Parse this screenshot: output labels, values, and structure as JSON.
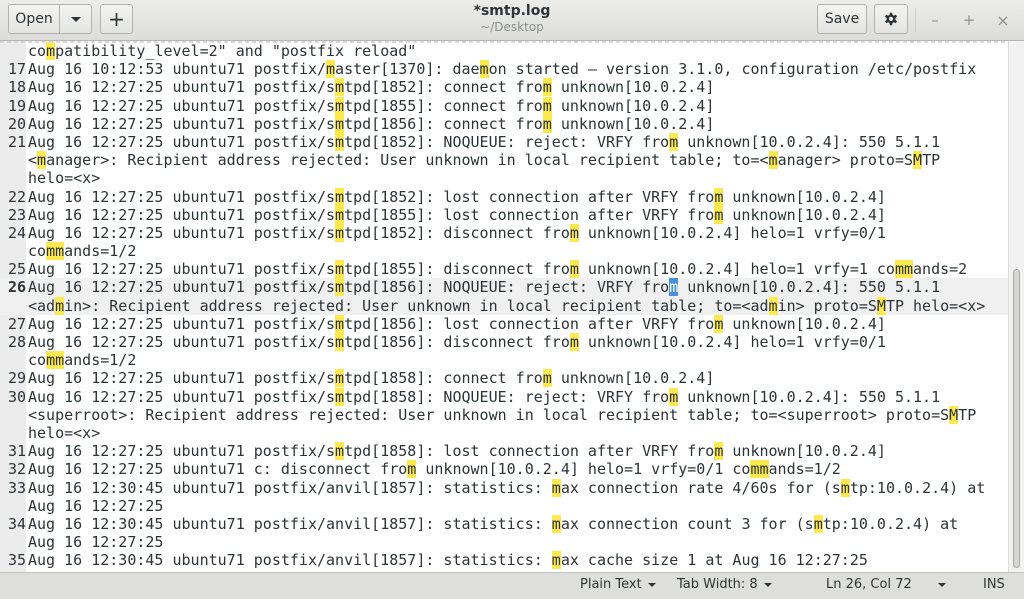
{
  "header": {
    "open_label": "Open",
    "new_tab_label": "+",
    "title": "*smtp.log",
    "subtitle": "~/Desktop",
    "save_label": "Save",
    "minimize_label": "–",
    "maximize_label": "+",
    "close_label": "×"
  },
  "editor": {
    "current_line": 26,
    "scroll": {
      "thumb_start": 0.43,
      "thumb_end": 1.0
    },
    "lines": [
      {
        "num": "",
        "rows": [
          [
            [
              "co"
            ],
            [
              "m",
              "hl"
            ],
            [
              "patibility_level=2\" and \"postfix reload\""
            ]
          ]
        ]
      },
      {
        "num": "17",
        "rows": [
          [
            [
              "Aug 16 10:12:53 ubuntu71 postfix/"
            ],
            [
              "m",
              "hl"
            ],
            [
              "aster[1370]: dae"
            ],
            [
              "m",
              "hl"
            ],
            [
              "on started – version 3.1.0, configuration /etc/postfix"
            ]
          ]
        ]
      },
      {
        "num": "18",
        "rows": [
          [
            [
              "Aug 16 12:27:25 ubuntu71 postfix/s"
            ],
            [
              "m",
              "hl"
            ],
            [
              "tpd[1852]: connect fro"
            ],
            [
              "m",
              "hl"
            ],
            [
              " unknown[10.0.2.4]"
            ]
          ]
        ]
      },
      {
        "num": "19",
        "rows": [
          [
            [
              "Aug 16 12:27:25 ubuntu71 postfix/s"
            ],
            [
              "m",
              "hl"
            ],
            [
              "tpd[1855]: connect fro"
            ],
            [
              "m",
              "hl"
            ],
            [
              " unknown[10.0.2.4]"
            ]
          ]
        ]
      },
      {
        "num": "20",
        "rows": [
          [
            [
              "Aug 16 12:27:25 ubuntu71 postfix/s"
            ],
            [
              "m",
              "hl"
            ],
            [
              "tpd[1856]: connect fro"
            ],
            [
              "m",
              "hl"
            ],
            [
              " unknown[10.0.2.4]"
            ]
          ]
        ]
      },
      {
        "num": "21",
        "rows": [
          [
            [
              "Aug 16 12:27:25 ubuntu71 postfix/s"
            ],
            [
              "m",
              "hl"
            ],
            [
              "tpd[1852]: NOQUEUE: reject: VRFY fro"
            ],
            [
              "m",
              "hl"
            ],
            [
              " unknown[10.0.2.4]: 550 5.1.1"
            ]
          ],
          [
            [
              "<"
            ],
            [
              "m",
              "hl"
            ],
            [
              "anager>: Recipient address rejected: User unknown in local recipient table; to=<"
            ],
            [
              "m",
              "hl"
            ],
            [
              "anager> proto=S"
            ],
            [
              "M",
              "hl"
            ],
            [
              "TP"
            ]
          ],
          [
            [
              "helo=<x>"
            ]
          ]
        ]
      },
      {
        "num": "22",
        "rows": [
          [
            [
              "Aug 16 12:27:25 ubuntu71 postfix/s"
            ],
            [
              "m",
              "hl"
            ],
            [
              "tpd[1852]: lost connection after VRFY fro"
            ],
            [
              "m",
              "hl"
            ],
            [
              " unknown[10.0.2.4]"
            ]
          ]
        ]
      },
      {
        "num": "23",
        "rows": [
          [
            [
              "Aug 16 12:27:25 ubuntu71 postfix/s"
            ],
            [
              "m",
              "hl"
            ],
            [
              "tpd[1855]: lost connection after VRFY fro"
            ],
            [
              "m",
              "hl"
            ],
            [
              " unknown[10.0.2.4]"
            ]
          ]
        ]
      },
      {
        "num": "24",
        "rows": [
          [
            [
              "Aug 16 12:27:25 ubuntu71 postfix/s"
            ],
            [
              "m",
              "hl"
            ],
            [
              "tpd[1852]: disconnect fro"
            ],
            [
              "m",
              "hl"
            ],
            [
              " unknown[10.0.2.4] helo=1 vrfy=0/1"
            ]
          ],
          [
            [
              "co"
            ],
            [
              "mm",
              "hl"
            ],
            [
              "ands=1/2"
            ]
          ]
        ]
      },
      {
        "num": "25",
        "rows": [
          [
            [
              "Aug 16 12:27:25 ubuntu71 postfix/s"
            ],
            [
              "m",
              "hl"
            ],
            [
              "tpd[1855]: disconnect fro"
            ],
            [
              "m",
              "hl"
            ],
            [
              " unknown[10.0.2.4] helo=1 vrfy=1 co"
            ],
            [
              "mm",
              "hl"
            ],
            [
              "ands=2"
            ]
          ]
        ]
      },
      {
        "num": "26",
        "rows": [
          [
            [
              "Aug 16 12:27:25 ubuntu71 postfix/s"
            ],
            [
              "m",
              "hl"
            ],
            [
              "tpd[1856]: NOQUEUE: reject: VRFY fro"
            ],
            [
              "m",
              "cur"
            ],
            [
              " unknown[10.0.2.4]: 550 5.1.1"
            ]
          ],
          [
            [
              "<ad"
            ],
            [
              "m",
              "hl"
            ],
            [
              "in>: Recipient address rejected: User unknown in local recipient table; to=<ad"
            ],
            [
              "m",
              "hl"
            ],
            [
              "in> proto=S"
            ],
            [
              "M",
              "hl"
            ],
            [
              "TP helo=<x>"
            ]
          ]
        ]
      },
      {
        "num": "27",
        "rows": [
          [
            [
              "Aug 16 12:27:25 ubuntu71 postfix/s"
            ],
            [
              "m",
              "hl"
            ],
            [
              "tpd[1856]: lost connection after VRFY fro"
            ],
            [
              "m",
              "hl"
            ],
            [
              " unknown[10.0.2.4]"
            ]
          ]
        ]
      },
      {
        "num": "28",
        "rows": [
          [
            [
              "Aug 16 12:27:25 ubuntu71 postfix/s"
            ],
            [
              "m",
              "hl"
            ],
            [
              "tpd[1856]: disconnect fro"
            ],
            [
              "m",
              "hl"
            ],
            [
              " unknown[10.0.2.4] helo=1 vrfy=0/1"
            ]
          ],
          [
            [
              "co"
            ],
            [
              "mm",
              "hl"
            ],
            [
              "ands=1/2"
            ]
          ]
        ]
      },
      {
        "num": "29",
        "rows": [
          [
            [
              "Aug 16 12:27:25 ubuntu71 postfix/s"
            ],
            [
              "m",
              "hl"
            ],
            [
              "tpd[1858]: connect fro"
            ],
            [
              "m",
              "hl"
            ],
            [
              " unknown[10.0.2.4]"
            ]
          ]
        ]
      },
      {
        "num": "30",
        "rows": [
          [
            [
              "Aug 16 12:27:25 ubuntu71 postfix/s"
            ],
            [
              "m",
              "hl"
            ],
            [
              "tpd[1858]: NOQUEUE: reject: VRFY fro"
            ],
            [
              "m",
              "hl"
            ],
            [
              " unknown[10.0.2.4]: 550 5.1.1"
            ]
          ],
          [
            [
              "<superroot>: Recipient address rejected: User unknown in local recipient table; to=<superroot> proto=S"
            ],
            [
              "M",
              "hl"
            ],
            [
              "TP"
            ]
          ],
          [
            [
              "helo=<x>"
            ]
          ]
        ]
      },
      {
        "num": "31",
        "rows": [
          [
            [
              "Aug 16 12:27:25 ubuntu71 postfix/s"
            ],
            [
              "m",
              "hl"
            ],
            [
              "tpd[1858]: lost connection after VRFY fro"
            ],
            [
              "m",
              "hl"
            ],
            [
              " unknown[10.0.2.4]"
            ]
          ]
        ]
      },
      {
        "num": "32",
        "rows": [
          [
            [
              "Aug 16 12:27:25 ubuntu71 c: disconnect fro"
            ],
            [
              "m",
              "hl"
            ],
            [
              " unknown[10.0.2.4] helo=1 vrfy=0/1 co"
            ],
            [
              "mm",
              "hl"
            ],
            [
              "ands=1/2"
            ]
          ]
        ]
      },
      {
        "num": "33",
        "rows": [
          [
            [
              "Aug 16 12:30:45 ubuntu71 postfix/anvil[1857]: statistics: "
            ],
            [
              "m",
              "hl"
            ],
            [
              "ax connection rate 4/60s for (s"
            ],
            [
              "m",
              "hl"
            ],
            [
              "tp:10.0.2.4) at"
            ]
          ],
          [
            [
              "Aug 16 12:27:25"
            ]
          ]
        ]
      },
      {
        "num": "34",
        "rows": [
          [
            [
              "Aug 16 12:30:45 ubuntu71 postfix/anvil[1857]: statistics: "
            ],
            [
              "m",
              "hl"
            ],
            [
              "ax connection count 3 for (s"
            ],
            [
              "m",
              "hl"
            ],
            [
              "tp:10.0.2.4) at"
            ]
          ],
          [
            [
              "Aug 16 12:27:25"
            ]
          ]
        ]
      },
      {
        "num": "35",
        "rows": [
          [
            [
              "Aug 16 12:30:45 ubuntu71 postfix/anvil[1857]: statistics: "
            ],
            [
              "m",
              "hl"
            ],
            [
              "ax cache size 1 at Aug 16 12:27:25"
            ]
          ]
        ]
      }
    ]
  },
  "statusbar": {
    "language": "Plain Text",
    "tab_width": "Tab Width: 8",
    "position": "Ln 26, Col 72",
    "mode": "INS"
  },
  "colors": {
    "highlight": "#fce94f",
    "cursor_selection": "#4a90d9",
    "current_line": "#f0f0f0"
  }
}
